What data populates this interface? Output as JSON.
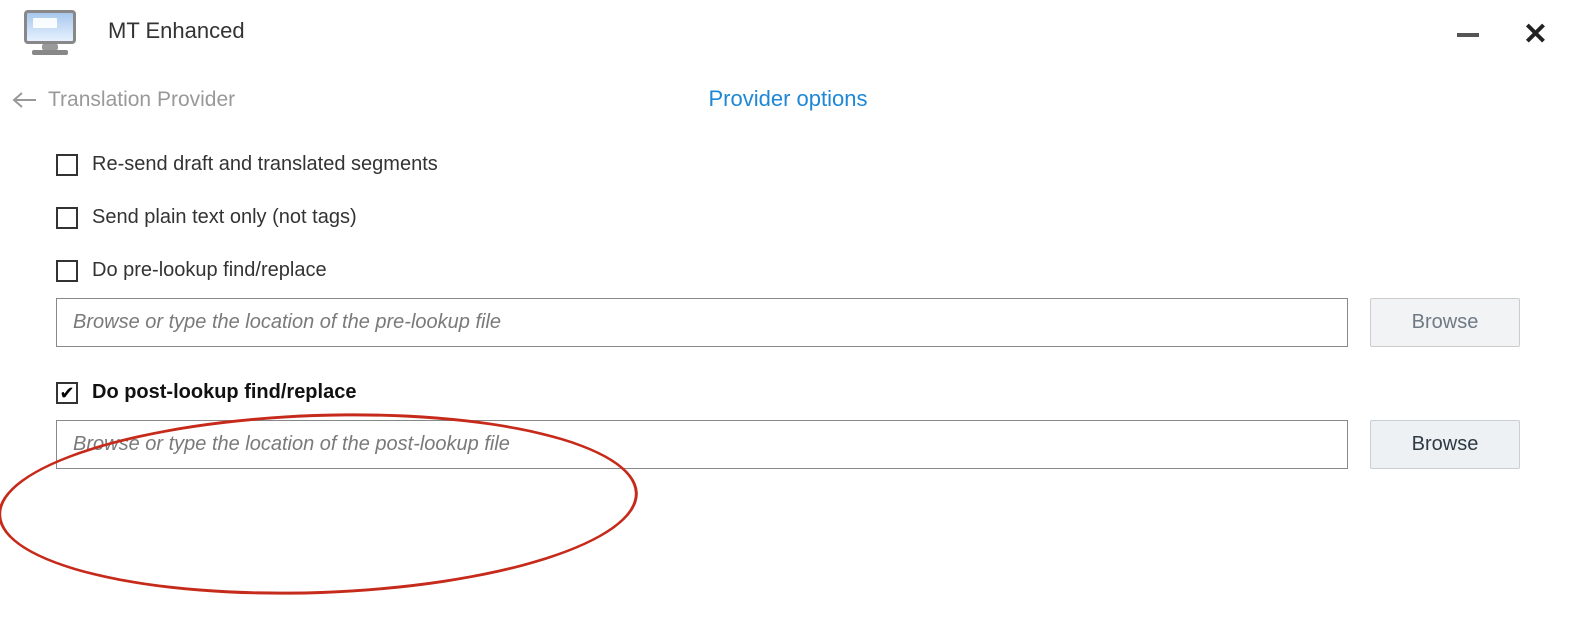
{
  "window": {
    "title": "MT Enhanced"
  },
  "breadcrumb": {
    "back": "Translation Provider"
  },
  "tab": {
    "current": "Provider options"
  },
  "options": {
    "resend": {
      "label": "Re-send draft and translated segments",
      "checked": false
    },
    "plaintext": {
      "label": "Send plain text only (not tags)",
      "checked": false
    },
    "prelookup": {
      "label": "Do pre-lookup find/replace",
      "checked": false,
      "placeholder": "Browse or type the location of the pre-lookup file",
      "browse": "Browse"
    },
    "postlookup": {
      "label": "Do post-lookup find/replace",
      "checked": true,
      "placeholder": "Browse or type the location of the post-lookup file",
      "browse": "Browse"
    }
  }
}
